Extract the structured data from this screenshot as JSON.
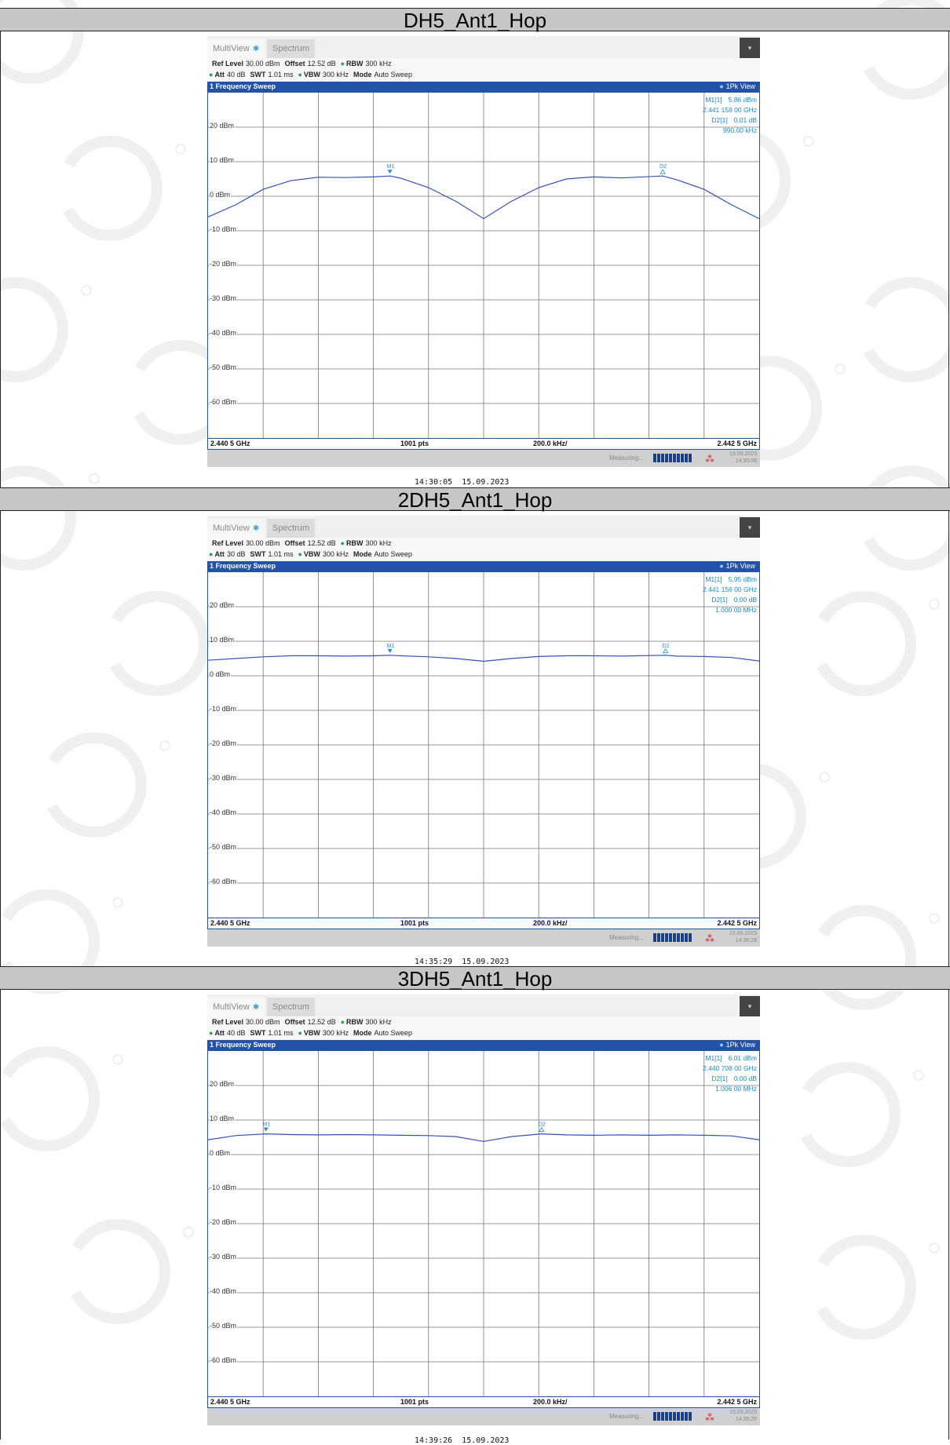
{
  "analyzer": {
    "tab_multiview": "MultiView",
    "tab_spectrum": "Spectrum",
    "ref_level_label": "Ref Level",
    "ref_level": "30.00 dBm",
    "offset_label": "Offset",
    "offset": "12.52 dB",
    "rbw_label": "RBW",
    "rbw": "300 kHz",
    "att_label": "Att",
    "swt_label": "SWT",
    "swt": "1.01 ms",
    "vbw_label": "VBW",
    "vbw": "300 kHz",
    "mode_label": "Mode",
    "mode": "Auto Sweep",
    "sweep_title": "1 Frequency Sweep",
    "view_label": "1Pk View",
    "x_start": "2.440 5 GHz",
    "points": "1001 pts",
    "span_per_div": "200.0 kHz/",
    "x_stop": "2.442 5 GHz",
    "measuring": "Measuring...",
    "ylabels": [
      "20 dBm",
      "10 dBm",
      "0 dBm",
      "-10 dBm",
      "-20 dBm",
      "-30 dBm",
      "-40 dBm",
      "-50 dBm",
      "-60 dBm"
    ]
  },
  "panels": [
    {
      "title": "DH5_Ant1_Hop",
      "att": "40 dB",
      "m1_label": "M1[1]",
      "m1_level": "5.86 dBm",
      "m1_freq": "2.441 158 00 GHz",
      "d2_label": "D2[1]",
      "d2_level": "0.01 dB",
      "d2_freq": "990.00 kHz",
      "status_date": "15.09.2023",
      "status_time": "14:30:08",
      "timestamp": "14:30:05  15.09.2023"
    },
    {
      "title": "2DH5_Ant1_Hop",
      "att": "30 dB",
      "m1_label": "M1[1]",
      "m1_level": "5.95 dBm",
      "m1_freq": "2.441 156 00 GHz",
      "d2_label": "D2[1]",
      "d2_level": "0.00 dB",
      "d2_freq": "1.000 00 MHz",
      "status_date": "15.09.2023",
      "status_time": "14:35:28",
      "timestamp": "14:35:29  15.09.2023"
    },
    {
      "title": "3DH5_Ant1_Hop",
      "att": "40 dB",
      "m1_label": "M1[1]",
      "m1_level": "6.01 dBm",
      "m1_freq": "2.440 708 00 GHz",
      "d2_label": "D2[1]",
      "d2_level": "0.00 dB",
      "d2_freq": "1.006 00 MHz",
      "status_date": "15.09.2023",
      "status_time": "14:39:25",
      "timestamp": "14:39:26  15.09.2023"
    }
  ],
  "chart_data": [
    {
      "type": "line",
      "title": "DH5_Ant1_Hop",
      "xlabel": "",
      "ylabel": "",
      "xlim": [
        2.4405,
        2.4425
      ],
      "ylim": [
        -70,
        30
      ],
      "x_unit": "GHz",
      "y_unit": "dBm",
      "grid": true,
      "series": [
        {
          "x": [
            2.4405,
            2.4406,
            2.4407,
            2.4408,
            2.4409,
            2.441,
            2.4411,
            2.44116,
            2.4412,
            2.4413,
            2.4414,
            2.4415,
            2.4416,
            2.4417,
            2.4418,
            2.4419,
            2.442,
            2.44215,
            2.4422,
            2.4423,
            2.4424,
            2.4425
          ],
          "y": [
            -6,
            -2.5,
            2,
            4.5,
            5.5,
            5.4,
            5.6,
            5.86,
            5.2,
            2.5,
            -1.5,
            -6.5,
            -1.5,
            2.5,
            5,
            5.6,
            5.3,
            5.87,
            4.8,
            2,
            -2.5,
            -6.5
          ]
        }
      ],
      "markers": [
        {
          "name": "M1",
          "x": 2.44116,
          "y": 5.86
        },
        {
          "name": "D2",
          "x": 2.44215,
          "y": 5.87
        }
      ]
    },
    {
      "type": "line",
      "title": "2DH5_Ant1_Hop",
      "xlabel": "",
      "ylabel": "",
      "xlim": [
        2.4405,
        2.4425
      ],
      "ylim": [
        -70,
        30
      ],
      "x_unit": "GHz",
      "y_unit": "dBm",
      "grid": true,
      "series": [
        {
          "x": [
            2.4405,
            2.4406,
            2.4407,
            2.4408,
            2.4409,
            2.441,
            2.4411,
            2.44116,
            2.4412,
            2.4413,
            2.4414,
            2.4415,
            2.4416,
            2.4417,
            2.4418,
            2.4419,
            2.442,
            2.44216,
            2.4422,
            2.4423,
            2.4424,
            2.4425
          ],
          "y": [
            4.5,
            5,
            5.5,
            5.8,
            5.8,
            5.7,
            5.8,
            5.95,
            5.8,
            5.5,
            5,
            4.2,
            5,
            5.6,
            5.8,
            5.8,
            5.7,
            5.95,
            5.7,
            5.6,
            5.3,
            4.3
          ]
        }
      ],
      "markers": [
        {
          "name": "M1",
          "x": 2.44116,
          "y": 5.95
        },
        {
          "name": "D2",
          "x": 2.44216,
          "y": 5.95
        }
      ]
    },
    {
      "type": "line",
      "title": "3DH5_Ant1_Hop",
      "xlabel": "",
      "ylabel": "",
      "xlim": [
        2.4405,
        2.4425
      ],
      "ylim": [
        -70,
        30
      ],
      "x_unit": "GHz",
      "y_unit": "dBm",
      "grid": true,
      "series": [
        {
          "x": [
            2.4405,
            2.4406,
            2.44071,
            2.4408,
            2.4409,
            2.441,
            2.4411,
            2.4412,
            2.4413,
            2.4414,
            2.4415,
            2.4416,
            2.44171,
            2.4418,
            2.4419,
            2.442,
            2.4421,
            2.4422,
            2.4423,
            2.4424,
            2.4425
          ],
          "y": [
            4.3,
            5.5,
            6.01,
            5.8,
            5.7,
            5.8,
            5.7,
            5.6,
            5.5,
            5.2,
            3.8,
            5.2,
            6.0,
            5.7,
            5.6,
            5.7,
            5.6,
            5.7,
            5.6,
            5.4,
            4.3
          ]
        }
      ],
      "markers": [
        {
          "name": "M1",
          "x": 2.44071,
          "y": 6.01
        },
        {
          "name": "D2",
          "x": 2.44171,
          "y": 6.01
        }
      ]
    }
  ]
}
